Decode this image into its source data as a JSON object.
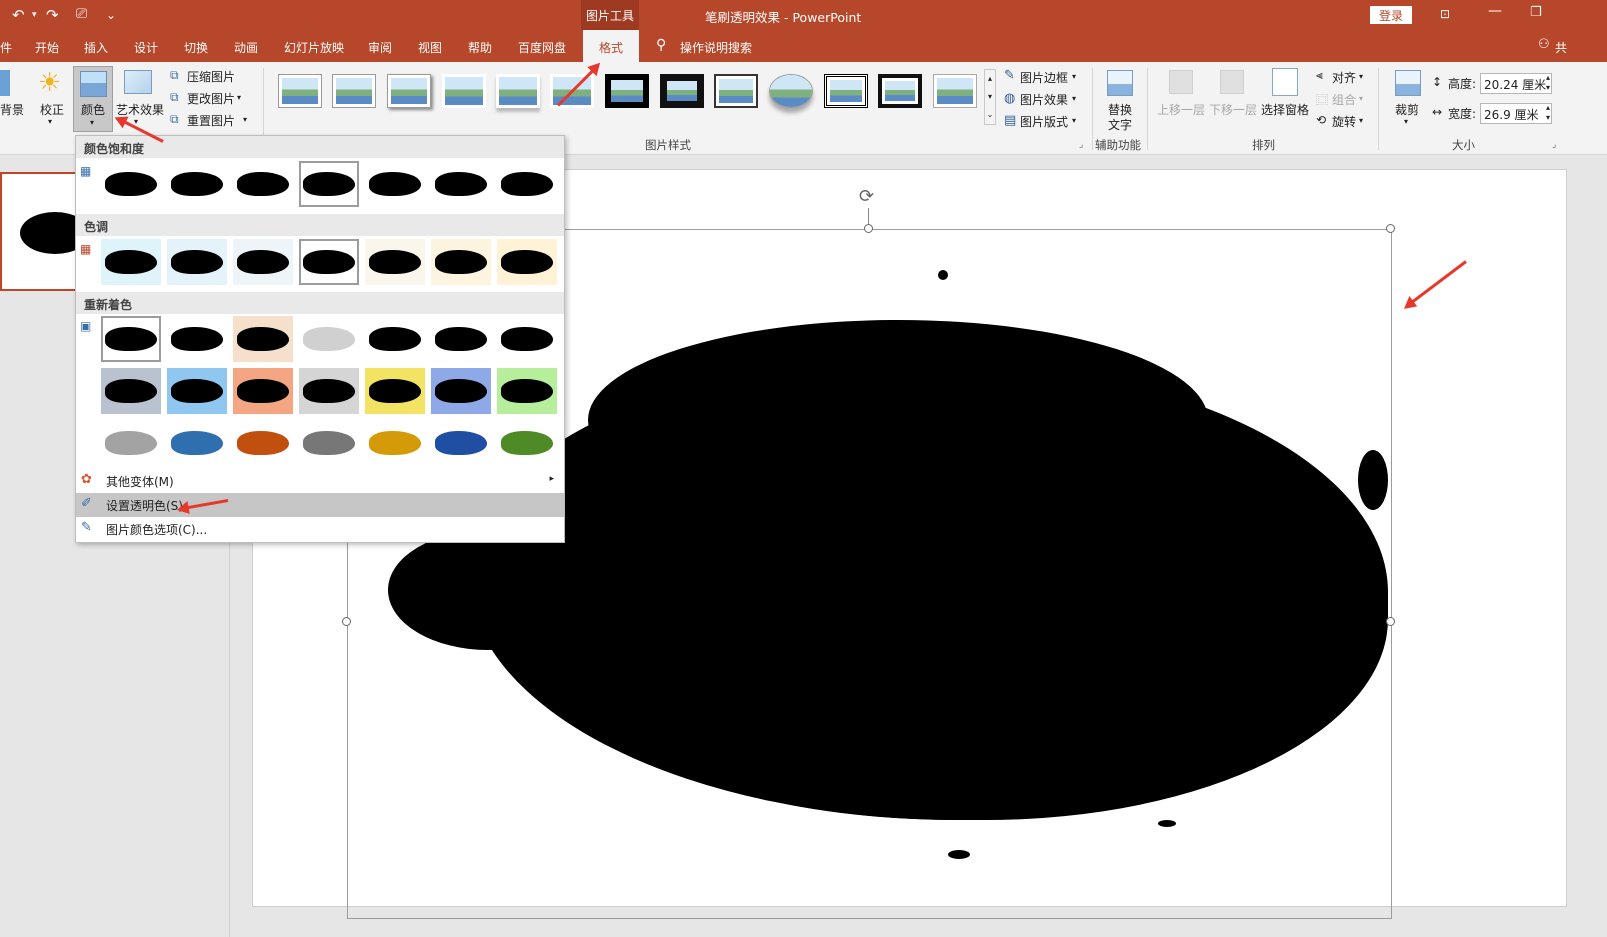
{
  "titlebar": {
    "context_tool": "图片工具",
    "title": "笔刷透明效果 - PowerPoint",
    "login": "登录",
    "qat_undo": "↶",
    "qat_redo": "↷",
    "qat_more": "⌄"
  },
  "tabs": [
    "件",
    "开始",
    "插入",
    "设计",
    "切换",
    "动画",
    "幻灯片放映",
    "审阅",
    "视图",
    "帮助",
    "百度网盘",
    "格式"
  ],
  "active_tab": "格式",
  "search_label": "操作说明搜索",
  "share_label": "共",
  "ribbon": {
    "bg_remove": "背景",
    "correct": "校正",
    "color": "颜色",
    "art_effect": "艺术效果",
    "compress": "压缩图片",
    "change_pic": "更改图片",
    "reset_pic": "重置图片",
    "group_styles": "图片样式",
    "border": "图片边框",
    "effect": "图片效果",
    "layout": "图片版式",
    "alt_text_l1": "替换",
    "alt_text_l2": "文字",
    "group_access": "辅助功能",
    "bring_forward": "上移一层",
    "send_backward": "下移一层",
    "selection_pane": "选择窗格",
    "align": "对齐",
    "group": "组合",
    "rotate": "旋转",
    "group_arrange": "排列",
    "crop": "裁剪",
    "height_label": "高度:",
    "height_value": "20.24 厘米",
    "width_label": "宽度:",
    "width_value": "26.9 厘米",
    "group_size": "大小"
  },
  "dropdown": {
    "sat_header": "颜色饱和度",
    "tone_header": "色调",
    "recolor_header": "重新着色",
    "more_variants": "其他变体(M)",
    "set_transparent": "设置透明色(S)",
    "color_options": "图片颜色选项(C)...",
    "tone_colors": [
      "#dff3fb",
      "#e4f2fa",
      "#eef5f8",
      "#ffffff",
      "#fbf6ec",
      "#fdf4df",
      "#fff2d6"
    ],
    "recolor_row2": [
      "#b9c2cf",
      "#8fc7f0",
      "#f4a582",
      "#d5d5d5",
      "#f2e462",
      "#8fa8e8",
      "#b6ee9c"
    ],
    "recolor_row3": [
      "#a3a3a3",
      "#2f6fb0",
      "#c1500f",
      "#777777",
      "#d49a07",
      "#1f4ea3",
      "#4e8a26"
    ],
    "recolor_row1_bg": [
      "#ffffff",
      "#ffffff",
      "#f6e0cc",
      "#ffffff",
      "#ffffff",
      "#ffffff",
      "#ffffff"
    ],
    "recolor_row1_ink": [
      "#000000",
      "#000000",
      "#000000",
      "#d0d0d0",
      "#000000",
      "#000000",
      "#000000"
    ]
  }
}
